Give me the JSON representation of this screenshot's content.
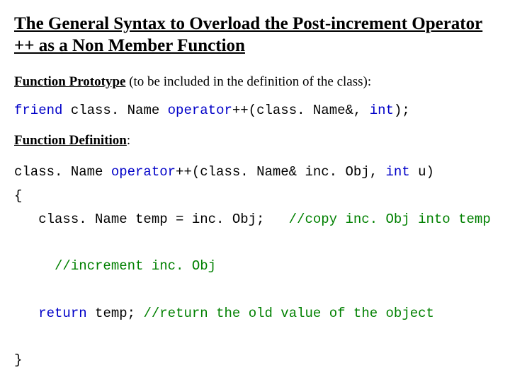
{
  "title": "The General Syntax to Overload the Post-increment Operator ++ as a Non Member Function",
  "proto": {
    "label": "Function Prototype",
    "rest": " (to be included in the definition of the class):",
    "kw_friend": "friend",
    "t1": " class. Name ",
    "kw_operator": "operator",
    "t2": "++(class. Name&, ",
    "kw_int": "int",
    "t3": ");"
  },
  "def": {
    "label": "Function Definition",
    "colon": ":",
    "l1_a": "class. Name ",
    "l1_op": "operator",
    "l1_b": "++(class. Name& inc. Obj, ",
    "l1_int": "int",
    "l1_c": " u)",
    "l2": "{",
    "l3_a": "   class. Name temp = inc. Obj;   ",
    "l3_cm": "//copy inc. Obj into temp",
    "l4_a": "     ",
    "l4_cm": "//increment inc. Obj",
    "l5_a": "   ",
    "l5_ret": "return",
    "l5_b": " temp; ",
    "l5_cm": "//return the old value of the object",
    "l6": "}"
  }
}
